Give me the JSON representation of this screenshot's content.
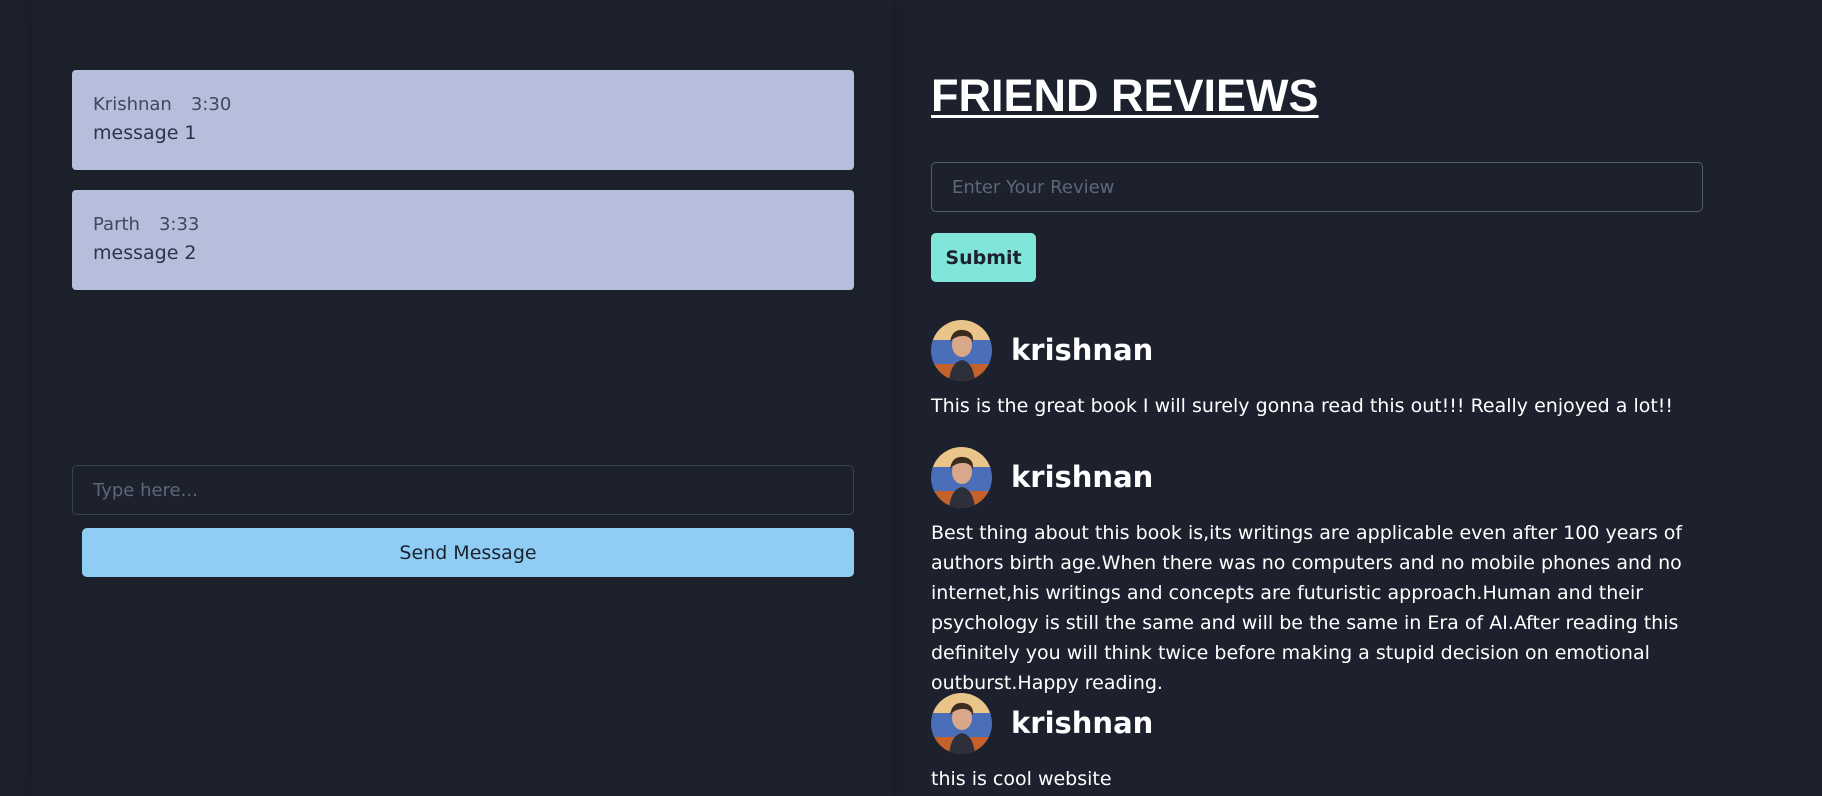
{
  "chat": {
    "messages": [
      {
        "sender": "Krishnan",
        "time": "3:30",
        "text": "message 1"
      },
      {
        "sender": "Parth",
        "time": "3:33",
        "text": "message 2"
      }
    ],
    "input_placeholder": "Type here...",
    "send_label": "Send Message"
  },
  "reviews": {
    "title": "FRIEND REVIEWS",
    "input_placeholder": "Enter Your Review",
    "submit_label": "Submit",
    "items": [
      {
        "name": "krishnan",
        "text": "This is the great book I will surely gonna read this out!!! Really enjoyed a lot!!"
      },
      {
        "name": "krishnan",
        "text": "Best thing about this book is,its writings are applicable even after 100 years of authors birth age.When there was no computers and no mobile phones and no internet,his writings and concepts are futuristic approach.Human and their psychology is still the same and will be the same in Era of AI.After reading this definitely you will think twice before making a stupid decision on emotional outburst.Happy reading."
      },
      {
        "name": "krishnan",
        "text": "this is cool website"
      }
    ]
  },
  "colors": {
    "background": "#1c212d",
    "message_card": "#b5bfdc",
    "send_button": "#90cdf4",
    "submit_button": "#81e6d9"
  },
  "icons": {
    "avatar": "user-avatar-photo"
  }
}
